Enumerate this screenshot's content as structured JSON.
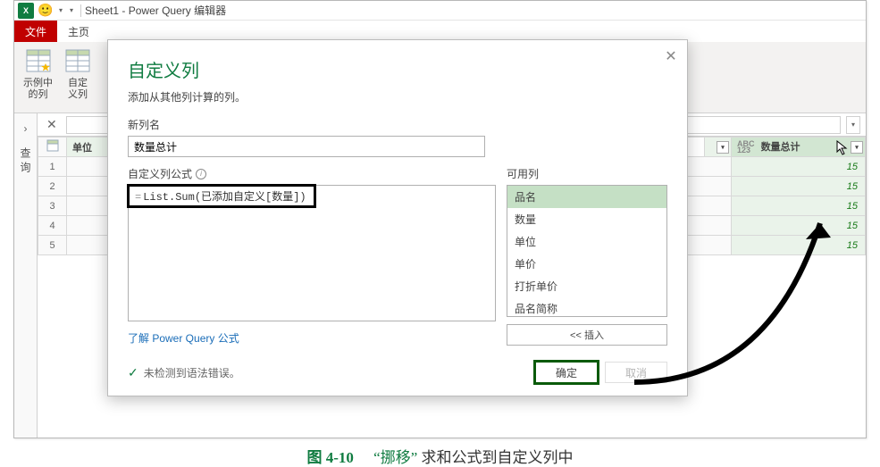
{
  "titlebar": {
    "excel_abbrev": "X",
    "title": "Sheet1 - Power Query 编辑器"
  },
  "ribbon": {
    "tab_file": "文件",
    "tab_home": "主页",
    "btn_from_example": "示例中\n的列",
    "btn_custom_col": "自定\n义列",
    "drop_symbol": "▾"
  },
  "sidebar": {
    "chevron": "›",
    "label": "查询"
  },
  "formula_bar": {
    "x": "✕",
    "drop": "▾"
  },
  "grid": {
    "col1_label": "单位",
    "col2_label": "数量总计",
    "type_prefix": "ABC\n123",
    "rows": [
      "1",
      "2",
      "3",
      "4",
      "5"
    ],
    "values": [
      "15",
      "15",
      "15",
      "15",
      "15"
    ],
    "drop": "▾"
  },
  "dialog": {
    "title": "自定义列",
    "subtitle": "添加从其他列计算的列。",
    "new_col_label": "新列名",
    "new_col_value": "数量总计",
    "formula_label": "自定义列公式",
    "formula_eq": "=",
    "formula_text": "List.Sum(已添加自定义[数量])",
    "avail_label": "可用列",
    "avail_items": [
      "品名",
      "数量",
      "单位",
      "单价",
      "打折单价",
      "品名简称"
    ],
    "insert_label": "<< 插入",
    "help_link": "了解 Power Query 公式",
    "status_text": "未检测到语法错误。",
    "btn_ok": "确定",
    "btn_cancel": "取消",
    "close": "✕",
    "check": "✓",
    "info_i": "i"
  },
  "caption": {
    "fig": "图 4-10",
    "text1": "“挪移”",
    "text2": "求和公式到自定义列中"
  }
}
